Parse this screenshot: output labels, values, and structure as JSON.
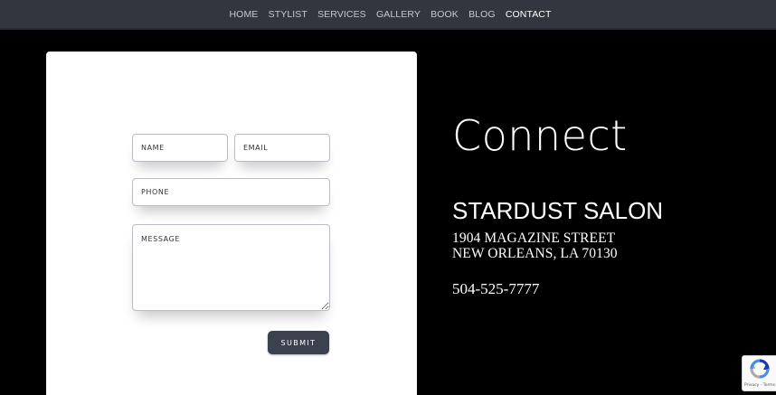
{
  "nav": {
    "items": [
      {
        "label": "HOME",
        "active": false
      },
      {
        "label": "STYLIST",
        "active": false
      },
      {
        "label": "SERVICES",
        "active": false
      },
      {
        "label": "GALLERY",
        "active": false
      },
      {
        "label": "BOOK",
        "active": false
      },
      {
        "label": "BLOG",
        "active": false
      },
      {
        "label": "CONTACT",
        "active": true
      }
    ]
  },
  "form": {
    "name_placeholder": "NAME",
    "email_placeholder": "EMAIL",
    "phone_placeholder": "PHONE",
    "message_placeholder": "MESSAGE",
    "submit_label": "SUBMIT"
  },
  "info": {
    "heading": "Connect",
    "salon_name": "STARDUST SALON",
    "address_line1": "1904 MAGAZINE STREET",
    "address_line2": "NEW ORLEANS, LA 70130",
    "phone": "504-525-7777"
  },
  "recaptcha": {
    "icon": "recaptcha-icon",
    "terms_label": "Privacy - Terms"
  },
  "colors": {
    "nav_background": "#33363f",
    "page_background": "#000000",
    "button_background": "#3c4150"
  }
}
